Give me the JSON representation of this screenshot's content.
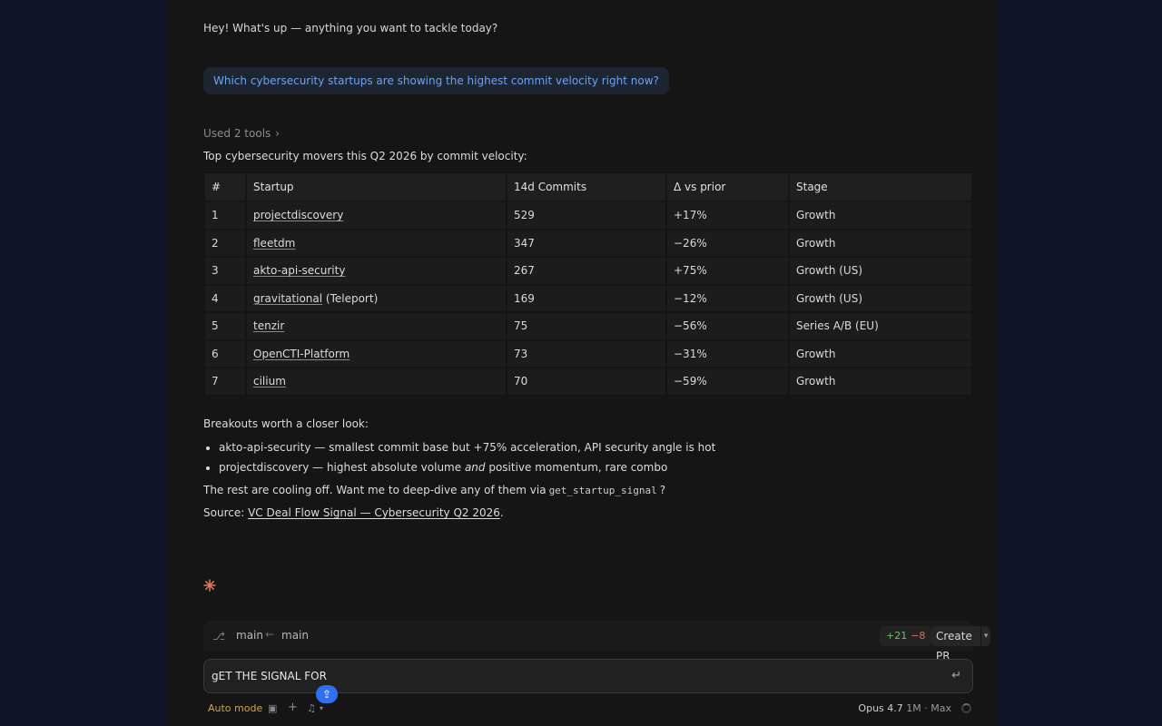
{
  "chat": {
    "greeting": "Hey! What's up — anything you want to tackle today?",
    "user_message": "Which cybersecurity startups are showing the highest commit velocity right now?",
    "tools_used": "Used 2 tools",
    "intro": "Top cybersecurity movers this Q2 2026 by commit velocity:",
    "table": {
      "headers": [
        "#",
        "Startup",
        "14d Commits",
        "Δ vs prior",
        "Stage"
      ],
      "rows": [
        {
          "rank": "1",
          "startup": "projectdiscovery",
          "suffix": "",
          "commits": "529",
          "delta": "+17%",
          "stage": "Growth"
        },
        {
          "rank": "2",
          "startup": "fleetdm",
          "suffix": "",
          "commits": "347",
          "delta": "−26%",
          "stage": "Growth"
        },
        {
          "rank": "3",
          "startup": "akto-api-security",
          "suffix": "",
          "commits": "267",
          "delta": "+75%",
          "stage": "Growth (US)"
        },
        {
          "rank": "4",
          "startup": "gravitational",
          "suffix": " (Teleport)",
          "commits": "169",
          "delta": "−12%",
          "stage": "Growth (US)"
        },
        {
          "rank": "5",
          "startup": "tenzir",
          "suffix": "",
          "commits": "75",
          "delta": "−56%",
          "stage": "Series A/B (EU)"
        },
        {
          "rank": "6",
          "startup": "OpenCTI-Platform",
          "suffix": "",
          "commits": "73",
          "delta": "−31%",
          "stage": "Growth"
        },
        {
          "rank": "7",
          "startup": "cilium",
          "suffix": "",
          "commits": "70",
          "delta": "−59%",
          "stage": "Growth"
        }
      ]
    },
    "breakouts_heading": "Breakouts worth a closer look:",
    "breakouts": [
      {
        "before": "akto-api-security — smallest commit base but +75% acceleration, API security angle is hot",
        "em": "",
        "after": ""
      },
      {
        "before": "projectdiscovery — highest absolute volume ",
        "em": "and",
        "after": " positive momentum, rare combo"
      }
    ],
    "rest_before": "The rest are cooling off. Want me to deep-dive any of them via",
    "rest_code": "get_startup_signal",
    "rest_after": "?",
    "source_label": "Source:",
    "source_link": "VC Deal Flow Signal — Cybersecurity Q2 2026",
    "source_end": "."
  },
  "branchbar": {
    "from": "main",
    "to": "main",
    "additions": "+21",
    "deletions": "−8",
    "create_pr": "Create PR"
  },
  "composer": {
    "value": "gET THE SIGNAL FOR"
  },
  "bottombar": {
    "mode": "Auto mode",
    "model": "Opus 4.7",
    "model_extra": "1M · Max"
  },
  "colors": {
    "accent": "#2f6ff0",
    "user_text": "#6ea2f0",
    "mode": "#d9a441",
    "add": "#6fbf73",
    "del": "#e06b5f"
  }
}
